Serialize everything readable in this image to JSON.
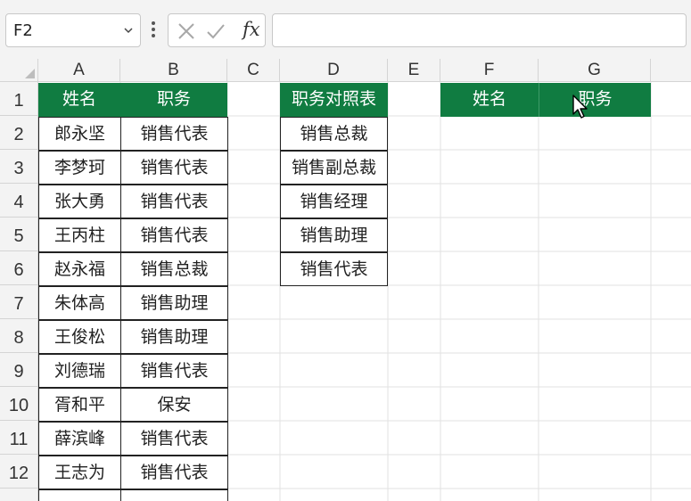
{
  "formula_bar": {
    "name_box": "F2",
    "fx_label": "fx",
    "formula": ""
  },
  "columns": [
    "A",
    "B",
    "C",
    "D",
    "E",
    "F",
    "G"
  ],
  "rows": [
    "1",
    "2",
    "3",
    "4",
    "5",
    "6",
    "7",
    "8",
    "9",
    "10",
    "11",
    "12"
  ],
  "table_a": {
    "headers": [
      "姓名",
      "职务"
    ],
    "rows": [
      [
        "郎永坚",
        "销售代表"
      ],
      [
        "李梦珂",
        "销售代表"
      ],
      [
        "张大勇",
        "销售代表"
      ],
      [
        "王丙柱",
        "销售代表"
      ],
      [
        "赵永福",
        "销售总裁"
      ],
      [
        "朱体高",
        "销售助理"
      ],
      [
        "王俊松",
        "销售助理"
      ],
      [
        "刘德瑞",
        "销售代表"
      ],
      [
        "胥和平",
        "保安"
      ],
      [
        "薛滨峰",
        "销售代表"
      ],
      [
        "王志为",
        "销售代表"
      ]
    ]
  },
  "table_d": {
    "header": "职务对照表",
    "items": [
      "销售总裁",
      "销售副总裁",
      "销售经理",
      "销售助理",
      "销售代表"
    ]
  },
  "table_fg": {
    "headers": [
      "姓名",
      "职务"
    ]
  },
  "colors": {
    "header_green": "#107c41",
    "grid_bg": "#f3f3f3"
  }
}
